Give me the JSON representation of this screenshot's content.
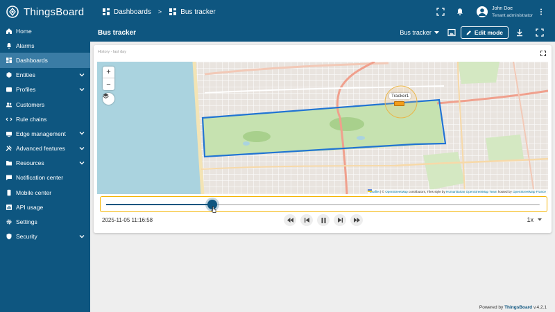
{
  "app": {
    "logo_text": "ThingsBoard"
  },
  "sidebar": {
    "items": [
      {
        "label": "Home",
        "icon": "home-icon",
        "expandable": false,
        "active": false
      },
      {
        "label": "Alarms",
        "icon": "bell-icon",
        "expandable": false,
        "active": false
      },
      {
        "label": "Dashboards",
        "icon": "dashboard-icon",
        "expandable": false,
        "active": true
      },
      {
        "label": "Entities",
        "icon": "entities-icon",
        "expandable": true,
        "active": false
      },
      {
        "label": "Profiles",
        "icon": "profiles-icon",
        "expandable": true,
        "active": false
      },
      {
        "label": "Customers",
        "icon": "customers-icon",
        "expandable": false,
        "active": false
      },
      {
        "label": "Rule chains",
        "icon": "rule-chains-icon",
        "expandable": false,
        "active": false
      },
      {
        "label": "Edge management",
        "icon": "edge-icon",
        "expandable": true,
        "active": false
      },
      {
        "label": "Advanced features",
        "icon": "tools-icon",
        "expandable": true,
        "active": false
      },
      {
        "label": "Resources",
        "icon": "folder-icon",
        "expandable": true,
        "active": false
      },
      {
        "label": "Notification center",
        "icon": "notification-icon",
        "expandable": false,
        "active": false
      },
      {
        "label": "Mobile center",
        "icon": "mobile-icon",
        "expandable": false,
        "active": false
      },
      {
        "label": "API usage",
        "icon": "api-icon",
        "expandable": false,
        "active": false
      },
      {
        "label": "Settings",
        "icon": "gear-icon",
        "expandable": false,
        "active": false
      },
      {
        "label": "Security",
        "icon": "shield-icon",
        "expandable": true,
        "active": false
      }
    ]
  },
  "topbar": {
    "breadcrumb": [
      {
        "label": "Dashboards"
      },
      {
        "label": "Bus tracker"
      }
    ],
    "separator": ">",
    "user": {
      "name": "John Doe",
      "role": "Tenant administrator"
    }
  },
  "dashboard": {
    "title": "Bus tracker",
    "state_label": "Bus tracker",
    "edit_label": "Edit mode"
  },
  "widget": {
    "title": "History - last day",
    "zoom_in": "+",
    "zoom_out": "−",
    "tracker_label": "Tracker1",
    "attribution": {
      "leaflet": "Leaflet",
      "part1": " | © ",
      "osm": "OpenStreetMap",
      "part2": " contributors, Tiles style by ",
      "hot": "Humanitarian OpenStreetMap Team",
      "part3": " hosted by ",
      "osmfr": "OpenStreetMap France"
    },
    "timeline": {
      "progress": 0.245
    },
    "timestamp": "2025-11-05 11:16:58",
    "speed": "1x"
  },
  "footer": {
    "prefix": "Powered by ",
    "brand": "ThingsBoard",
    "version": " v.4.2.1"
  },
  "colors": {
    "primary": "#0e5680",
    "active_item": "#3a7ca5",
    "route": "#2174d3",
    "highlight": "#f4b400",
    "marker": "#f29d1b"
  }
}
